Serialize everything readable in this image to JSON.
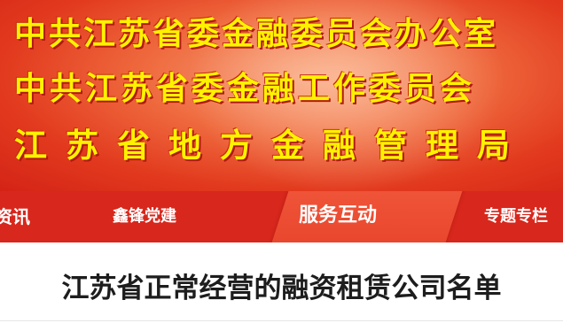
{
  "banner": {
    "line1": "中共江苏省委金融委员会办公室",
    "line2": "中共江苏省委金融工作委员会",
    "line3": "江苏省地方金融管理局",
    "text_color": "#fff200",
    "background_color": "#e23a1e"
  },
  "nav": {
    "items": [
      {
        "label": "资讯",
        "active": false
      },
      {
        "label": "鑫锋党建",
        "active": false
      },
      {
        "label": "服务互动",
        "active": true
      },
      {
        "label": "专题专栏",
        "active": false
      }
    ],
    "bar_color": "#d8271c",
    "active_color": "#ee4f33"
  },
  "page": {
    "title": "江苏省正常经营的融资租赁公司名单"
  }
}
